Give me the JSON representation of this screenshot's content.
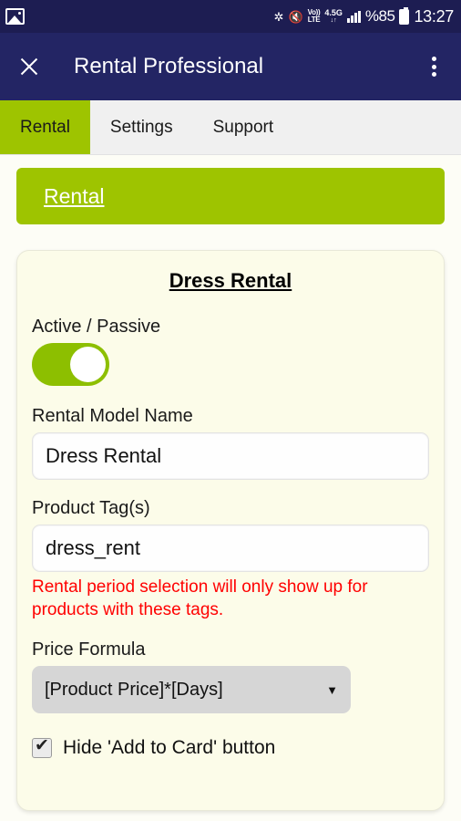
{
  "status_bar": {
    "notification_icon": "photo-icon",
    "bluetooth_icon": "bluetooth-icon",
    "sound_icon": "vibrate-mute-icon",
    "volte_line1": "Vo))",
    "volte_line2": "LTE",
    "network_type": "4.5G",
    "network_arrows": "↓↑",
    "signal_icon": "signal-bars-icon",
    "battery_percent": "%85",
    "battery_icon": "battery-icon",
    "time": "13:27"
  },
  "appbar": {
    "close_icon": "close-icon",
    "title": "Rental Professional",
    "overflow_icon": "overflow-menu-icon"
  },
  "tabs": [
    {
      "label": "Rental",
      "active": true
    },
    {
      "label": "Settings",
      "active": false
    },
    {
      "label": "Support",
      "active": false
    }
  ],
  "banner": {
    "link_label": "Rental"
  },
  "card": {
    "title": "Dress Rental",
    "active_passive": {
      "label": "Active / Passive",
      "state": "on"
    },
    "rental_model_name": {
      "label": "Rental Model Name",
      "value": "Dress Rental",
      "placeholder": "Rental Model Name"
    },
    "product_tags": {
      "label": "Product Tag(s)",
      "value": "dress_rent",
      "placeholder": "Product Tag(s)",
      "helper_text": "Rental period selection will only show up for products with these tags."
    },
    "price_formula": {
      "label": "Price Formula",
      "selected": "[Product Price]*[Days]",
      "caret_icon": "chevron-down-icon"
    },
    "hide_add_to_card": {
      "label": "Hide 'Add to Card' button",
      "checked": true
    }
  },
  "colors": {
    "navy": "#232564",
    "green": "#9ec400",
    "toggle_green": "#8dbf00",
    "card_bg": "#fcfce9",
    "error_red": "#ff0000",
    "select_gray": "#d6d6d6"
  }
}
